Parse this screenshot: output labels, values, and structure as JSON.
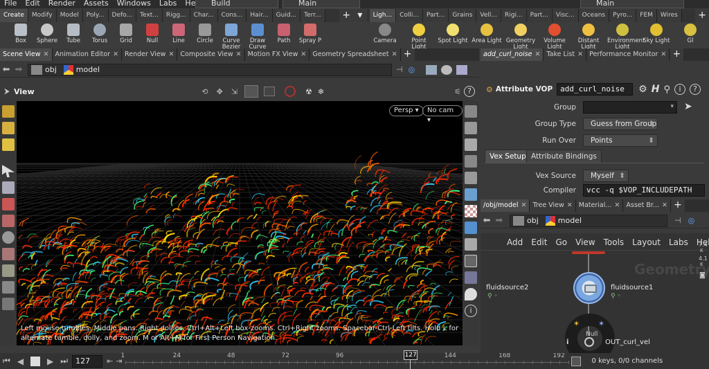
{
  "menubar": {
    "items": [
      "File",
      "Edit",
      "Render",
      "Assets",
      "Windows",
      "Labs",
      "Help"
    ],
    "desktop_label": "Build",
    "context_label": "Main",
    "context_label2": "Main"
  },
  "shelf_tabs_left": [
    "Create",
    "Modify",
    "Model",
    "Poly...",
    "Defo...",
    "Text...",
    "Rigg...",
    "Char...",
    "Cons...",
    "Hair...",
    "Guid...",
    "Terr..."
  ],
  "shelf_tabs_right": [
    "Ligh...",
    "Colli...",
    "Part...",
    "Grains",
    "Vell...",
    "Rigi...",
    "Part...",
    "Visc...",
    "Oceans",
    "Pyro...",
    "FEM",
    "Wires"
  ],
  "tools_left": [
    {
      "label": "Box",
      "icon": "box-icon",
      "color": "#b9c0c8"
    },
    {
      "label": "Sphere",
      "icon": "sphere-icon",
      "color": "#c8c8c8"
    },
    {
      "label": "Tube",
      "icon": "tube-icon",
      "color": "#b6bcc4"
    },
    {
      "label": "Torus",
      "icon": "torus-icon",
      "color": "#9aa6b3"
    },
    {
      "label": "Grid",
      "icon": "grid-icon",
      "color": "#a7a7a7"
    },
    {
      "label": "Null",
      "icon": "null-icon",
      "color": "#d04040"
    },
    {
      "label": "Line",
      "icon": "line-icon",
      "color": "#cc6677"
    },
    {
      "label": "Circle",
      "icon": "circle-icon",
      "color": "#999"
    },
    {
      "label": "Curve Bezier",
      "icon": "curve-bezier-icon",
      "color": "#7da6d6"
    },
    {
      "label": "Draw Curve",
      "icon": "draw-curve-icon",
      "color": "#5c8fd1"
    },
    {
      "label": "Path",
      "icon": "path-icon",
      "color": "#c86070"
    },
    {
      "label": "Spray P",
      "icon": "spray-paint-icon",
      "color": "#d36b6b"
    }
  ],
  "tools_right": [
    {
      "label": "Camera",
      "icon": "camera-icon",
      "color": "#888"
    },
    {
      "label": "Point Light",
      "icon": "point-light-icon",
      "color": "#f0d040"
    },
    {
      "label": "Spot Light",
      "icon": "spot-light-icon",
      "color": "#f0e070"
    },
    {
      "label": "Area Light",
      "icon": "area-light-icon",
      "color": "#e8c040"
    },
    {
      "label": "Geometry Light",
      "icon": "geometry-light-icon",
      "color": "#f0d060"
    },
    {
      "label": "Volume Light",
      "icon": "volume-light-icon",
      "color": "#e05030"
    },
    {
      "label": "Distant Light",
      "icon": "distant-light-icon",
      "color": "#f0c040"
    },
    {
      "label": "Environment Light",
      "icon": "environment-light-icon",
      "color": "#d0c040"
    },
    {
      "label": "Sky Light",
      "icon": "sky-light-icon",
      "color": "#e0c030"
    },
    {
      "label": "Gl",
      "icon": "gi-light-icon",
      "color": "#d8c040"
    }
  ],
  "left_pane_tabs": [
    "Scene View",
    "Animation Editor",
    "Render View",
    "Composite View",
    "Motion FX View",
    "Geometry Spreadsheet"
  ],
  "right_pane_tabs": [
    "add_curl_noise",
    "Take List",
    "Performance Monitor"
  ],
  "right_pane_tabs2": [
    "/obj/model",
    "Tree View",
    "Material...",
    "Asset Br..."
  ],
  "path": {
    "obj": "obj",
    "model": "model"
  },
  "viewport": {
    "title": "View",
    "persp": "Persp",
    "cam": "No cam",
    "hint": "Left mouse tumbles. Middle pans. Right dollies. Ctrl+Alt+Left box-zooms. Ctrl+Right zooms. Spacebar-Ctrl-Left tilts. Hold L for alternate tumble, dolly, and zoom.     M or Alt+M for First Person Navigation."
  },
  "params": {
    "node_type": "Attribute VOP",
    "node_name": "add_curl_noise",
    "group_label": "Group",
    "group_value": "",
    "group_type_label": "Group Type",
    "group_type_value": "Guess from Group",
    "run_over_label": "Run Over",
    "run_over_value": "Points",
    "tab_vex_setup": "Vex Setup",
    "tab_attr_bindings": "Attribute Bindings",
    "vex_source_label": "Vex Source",
    "vex_source_value": "Myself",
    "compiler_label": "Compiler",
    "compiler_value": "vcc -q $VOP_INCLUDEPATH"
  },
  "network": {
    "menu": [
      "Add",
      "Edit",
      "Go",
      "View",
      "Tools",
      "Layout",
      "Labs",
      "Help"
    ],
    "watermark": "Geometry",
    "nodes": {
      "fluidsource2": "fluidsource2",
      "fluidsource1": "fluidsource1",
      "null": "Null",
      "out": "OUT_curl_vel"
    },
    "side_readout": [
      "7.4",
      "K",
      "4.1",
      "K"
    ]
  },
  "timeline": {
    "frame": "127",
    "ticks": [
      "1",
      "24",
      "48",
      "72",
      "96",
      "127",
      "144",
      "168",
      "192"
    ],
    "marker": "127",
    "keys": "0 keys, 0/0 channels"
  },
  "colors": {
    "accent": "#f5a623",
    "fire_red": "#ff2a00",
    "fire_yellow": "#ffd800"
  }
}
